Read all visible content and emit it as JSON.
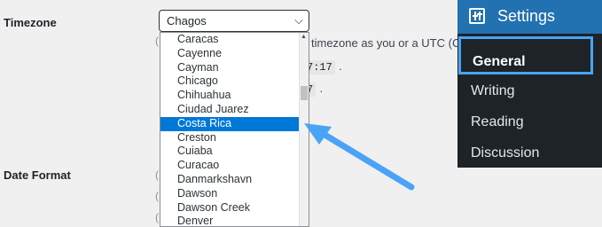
{
  "timezone": {
    "label": "Timezone",
    "selected": "Chagos",
    "behind_text": "timezone as you or a UTC (Coordinat",
    "time_snippet_1": "7:17",
    "time_snippet_2": "7",
    "dropdown_items": [
      "Caracas",
      "Cayenne",
      "Cayman",
      "Chicago",
      "Chihuahua",
      "Ciudad Juarez",
      "Costa Rica",
      "Creston",
      "Cuiaba",
      "Curacao",
      "Danmarkshavn",
      "Dawson",
      "Dawson Creek",
      "Denver"
    ]
  },
  "date_format": {
    "label": "Date Format"
  },
  "settings_menu": {
    "title": "Settings",
    "items": [
      "General",
      "Writing",
      "Reading",
      "Discussion"
    ]
  },
  "colors": {
    "highlight": "#0078d7",
    "callout": "#4aa3f5",
    "wp_blue": "#2271b1"
  }
}
